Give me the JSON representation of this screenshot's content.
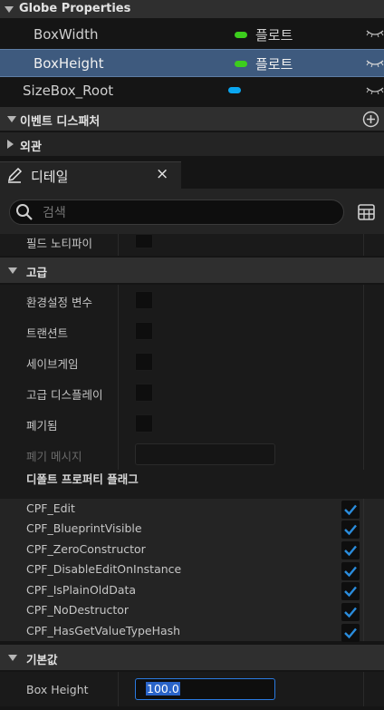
{
  "variables": {
    "header": "Globe Properties",
    "items": [
      {
        "name": "BoxWidth",
        "type": "플로트",
        "selected": false
      },
      {
        "name": "BoxHeight",
        "type": "플로트",
        "selected": true
      },
      {
        "name": "SizeBox_Root",
        "type": "",
        "selected": false
      }
    ],
    "float_color": "#3ccd1d",
    "widget_color": "#0aa6f0"
  },
  "event_dispatcher": {
    "label": "이벤트 디스패처"
  },
  "appearance": {
    "label": "외관"
  },
  "details_tab": {
    "label": "디테일",
    "close": "×"
  },
  "search": {
    "placeholder": "검색"
  },
  "field_notify": {
    "label": "필드 노티파이"
  },
  "advanced": {
    "label": "고급",
    "rows": [
      {
        "label": "환경설정 변수"
      },
      {
        "label": "트랜션트"
      },
      {
        "label": "세이브게임"
      },
      {
        "label": "고급 디스플레이"
      },
      {
        "label": "폐기됨"
      }
    ],
    "deprecation_message": "폐기 메시지"
  },
  "default_flags": {
    "label": "디폴트 프로퍼티 플래그",
    "flags": [
      {
        "name": "CPF_Edit",
        "checked": true
      },
      {
        "name": "CPF_BlueprintVisible",
        "checked": true
      },
      {
        "name": "CPF_ZeroConstructor",
        "checked": true
      },
      {
        "name": "CPF_DisableEditOnInstance",
        "checked": true
      },
      {
        "name": "CPF_IsPlainOldData",
        "checked": true
      },
      {
        "name": "CPF_NoDestructor",
        "checked": true
      },
      {
        "name": "CPF_HasGetValueTypeHash",
        "checked": true
      }
    ]
  },
  "default_value": {
    "label": "기본값",
    "field_label": "Box Height",
    "field_value": "100.0"
  }
}
